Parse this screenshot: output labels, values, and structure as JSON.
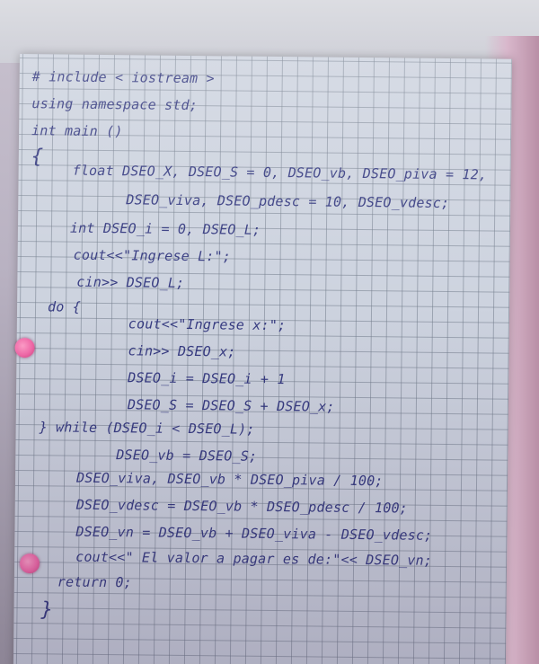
{
  "code_lines": [
    "# include < iostream >",
    "using namespace std;",
    "int main ()",
    "{",
    "float DSEO_X, DSEO_S = 0, DSEO_vb, DSEO_piva = 12,",
    "DSEO_viva, DSEO_pdesc = 10, DSEO_vdesc;",
    "int DSEO_i = 0, DSEO_L;",
    "cout<<\"Ingrese L:\";",
    "cin>> DSEO_L;",
    "do {",
    "cout<<\"Ingrese x:\";",
    "cin>> DSEO_x;",
    "DSEO_i = DSEO_i + 1",
    "DSEO_S = DSEO_S + DSEO_x;",
    "} while (DSEO_i < DSEO_L);",
    "DSEO_vb = DSEO_S;",
    "DSEO_viva, DSEO_vb * DSEO_piva / 100;",
    "DSEO_vdesc = DSEO_vb * DSEO_pdesc / 100;",
    "DSEO_vn = DSEO_vb + DSEO_viva - DSEO_vdesc;",
    "cout<<\" El valor a pagar es de:\"<< DSEO_vn;",
    "return 0;",
    "}"
  ]
}
